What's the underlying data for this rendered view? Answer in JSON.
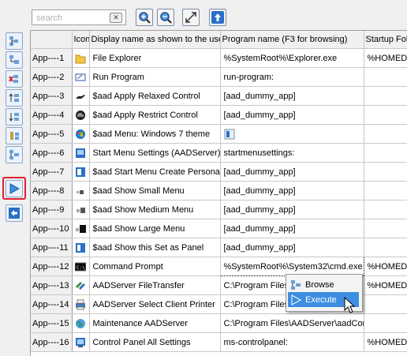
{
  "search": {
    "placeholder": "search"
  },
  "toolbar": {
    "left_buttons": [
      "add-item-icon",
      "add-subitem-icon",
      "delete-item-icon",
      "move-up-icon",
      "move-down-icon",
      "edit-icon",
      "properties-icon",
      "execute-icon",
      "back-icon"
    ],
    "top_buttons": [
      "zoom-in-icon",
      "zoom-out-icon",
      "expand-icon",
      "upload-icon"
    ]
  },
  "columns": {
    "row": "",
    "icon": "Icon",
    "display": "Display name as shown to the user",
    "program": "Program name (F3 for browsing)",
    "startup": "Startup Folder"
  },
  "rows": [
    {
      "id": "App----1",
      "icon": "folder-icon",
      "display": "File Explorer",
      "program": "%SystemRoot%\\Explorer.exe",
      "startup": "%HOMEDRIVE%"
    },
    {
      "id": "App----2",
      "icon": "run-icon",
      "display": "Run Program",
      "program": "run-program:",
      "startup": ""
    },
    {
      "id": "App----3",
      "icon": "hand-icon",
      "display": "$aad Apply Relaxed Control",
      "program": "[aad_dummy_app]",
      "startup": ""
    },
    {
      "id": "App----4",
      "icon": "stop-hand-icon",
      "display": "$aad Apply Restrict Control",
      "program": "[aad_dummy_app]",
      "startup": ""
    },
    {
      "id": "App----5",
      "icon": "windows-icon",
      "display": "$aad Menu: Windows 7 theme",
      "program": "",
      "startup": ""
    },
    {
      "id": "App----6",
      "icon": "start-menu-icon",
      "display": "Start Menu Settings (AADServer)",
      "program": "startmenusettings:",
      "startup": ""
    },
    {
      "id": "App----7",
      "icon": "create-panel-icon",
      "display": "$aad Start Menu Create Personal",
      "program": "[aad_dummy_app]",
      "startup": ""
    },
    {
      "id": "App----8",
      "icon": "small-menu-icon",
      "display": "$aad Show Small Menu",
      "program": "[aad_dummy_app]",
      "startup": ""
    },
    {
      "id": "App----9",
      "icon": "medium-menu-icon",
      "display": "$aad Show Medium Menu",
      "program": "[aad_dummy_app]",
      "startup": ""
    },
    {
      "id": "App----10",
      "icon": "large-menu-icon",
      "display": "$aad Show Large Menu",
      "program": "[aad_dummy_app]",
      "startup": ""
    },
    {
      "id": "App----11",
      "icon": "panel-icon",
      "display": "$aad Show this Set as Panel",
      "program": "[aad_dummy_app]",
      "startup": ""
    },
    {
      "id": "App----12",
      "icon": "cmd-icon",
      "display": "Command Prompt",
      "program": "%SystemRoot%\\System32\\cmd.exe",
      "startup": "%HOMEDRIVE%"
    },
    {
      "id": "App----13",
      "icon": "transfer-icon",
      "display": "AADServer FileTransfer",
      "program": "C:\\Program Files",
      "startup": "%HOMEDRIVE%"
    },
    {
      "id": "App----14",
      "icon": "printer-icon",
      "display": "AADServer Select Client Printer",
      "program": "C:\\Program Files",
      "startup": ""
    },
    {
      "id": "App----15",
      "icon": "globe-icon",
      "display": "Maintenance AADServer",
      "program": "C:\\Program Files\\AADServer\\aadCon",
      "startup": ""
    },
    {
      "id": "App----16",
      "icon": "control-panel-icon",
      "display": "Control Panel All Settings",
      "program": "ms-controlpanel:",
      "startup": "%HOMEDRIVE%"
    }
  ],
  "context_menu": {
    "items": [
      "Browse",
      "Execute"
    ],
    "highlighted": "Execute"
  },
  "colors": {
    "accent": "#3d8ee0",
    "play_highlight": "#e0202e"
  }
}
